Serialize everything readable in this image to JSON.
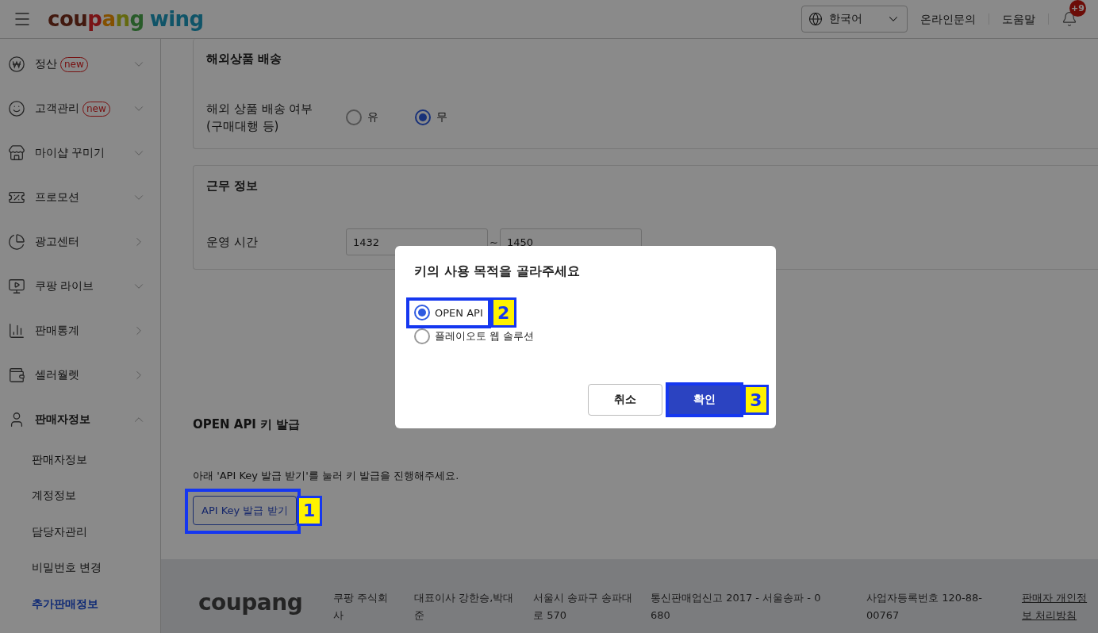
{
  "header": {
    "logo": {
      "brand": "coupang",
      "product": "wing"
    },
    "language": "한국어",
    "links": [
      "온라인문의",
      "도움말"
    ],
    "notifications": "+9"
  },
  "sidebar": {
    "items": [
      {
        "label": "정산",
        "badge": "new",
        "kind": "group",
        "expanded": false
      },
      {
        "label": "고객관리",
        "badge": "new",
        "kind": "group",
        "expanded": false
      },
      {
        "label": "마이샵 꾸미기",
        "kind": "group",
        "expanded": false
      },
      {
        "label": "프로모션",
        "kind": "group",
        "expanded": false
      },
      {
        "label": "광고센터",
        "kind": "link"
      },
      {
        "label": "쿠팡 라이브",
        "kind": "group",
        "expanded": false
      },
      {
        "label": "판매통계",
        "kind": "link"
      },
      {
        "label": "셀러월렛",
        "kind": "link"
      },
      {
        "label": "판매자정보",
        "kind": "group",
        "expanded": true,
        "children": [
          {
            "label": "판매자정보",
            "selected": false
          },
          {
            "label": "계정정보",
            "selected": false
          },
          {
            "label": "담당자관리",
            "selected": false
          },
          {
            "label": "비밀번호 변경",
            "selected": false
          },
          {
            "label": "추가판매정보",
            "selected": true
          }
        ]
      }
    ]
  },
  "sections": [
    {
      "title": "해외상품 배송",
      "label_lines": [
        "해외 상품 배송 여부",
        "(구매대행 등)"
      ],
      "kind": "radios",
      "options": [
        {
          "label": "유",
          "selected": false
        },
        {
          "label": "무",
          "selected": true
        }
      ]
    },
    {
      "title": "근무 정보",
      "label_lines": [
        "운영 시간"
      ],
      "kind": "range",
      "from": "1432",
      "separator": "~",
      "to": "1450"
    }
  ],
  "api_key": {
    "title": "OPEN API 키 발급",
    "description": "아래 'API Key 발급 받기'를 눌러 키 발급을 진행해주세요.",
    "button": "API Key 발급 받기",
    "callout": "1"
  },
  "footer": {
    "logo": "coupang",
    "columns": [
      "쿠팡 주식회사",
      "대표이사 강한승,박대준",
      "서울시 송파구 송파대로 570",
      "통신판매업신고 2017 - 서울송파 - 0680",
      "사업자등록번호 120-88-00767"
    ],
    "link": "판매자 개인정보 처리방침"
  },
  "dialog": {
    "title": "키의 사용 목적을 골라주세요",
    "options": [
      {
        "label": "OPEN API",
        "selected": true,
        "callout": "2"
      },
      {
        "label": "플레이오토 웹 솔루션",
        "selected": false
      }
    ],
    "buttons": [
      {
        "label": "취소",
        "kind": "secondary"
      },
      {
        "label": "확인",
        "kind": "primary",
        "callout": "3"
      }
    ]
  }
}
